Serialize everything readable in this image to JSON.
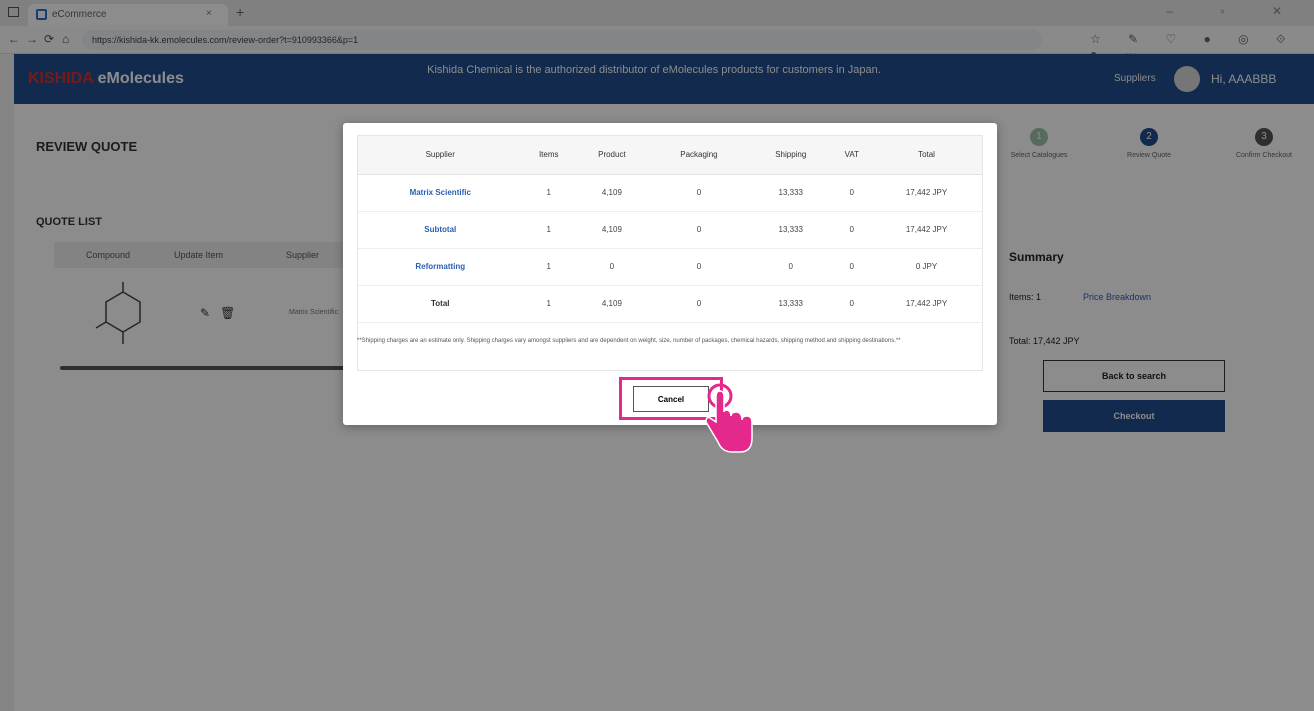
{
  "browser": {
    "tab_title": "eCommerce",
    "tab_close": "×",
    "new_tab": "+",
    "window_controls": "– ▫ ✕",
    "nav": {
      "back": "←",
      "forward": "→",
      "refresh": "⟳",
      "home": "⌂"
    },
    "url": "https://kishida-kk.emolecules.com/review-order?t=910993366&p=1",
    "extensions": "☆ ✎ ♡ ● ◎ ⟐ ● ⋯"
  },
  "header": {
    "logo_brand": "KISHIDA",
    "logo_product": "eMolecules",
    "banner": "Kishida Chemical is the authorized distributor of eMolecules products for customers in Japan.",
    "supplier_link": "Suppliers",
    "greeting": "Hi, AAABBB"
  },
  "page": {
    "title": "REVIEW QUOTE",
    "quote_list_label": "QUOTE LIST",
    "quote_columns": [
      "Compound",
      "Update Item",
      "Supplier"
    ],
    "row_supplier": "Matrix Scientific",
    "steps": [
      {
        "num": "1",
        "label": "Select Catalogues",
        "color": "#9cc3a6"
      },
      {
        "num": "2",
        "label": "Review Quote",
        "color": "#1f4e8c"
      },
      {
        "num": "3",
        "label": "Confirm Checkout",
        "color": "#555555"
      }
    ]
  },
  "summary": {
    "title": "Summary",
    "items": "Items: 1",
    "price_breakdown": "Price Breakdown",
    "total": "Total: 17,442 JPY",
    "back_button": "Back to search",
    "checkout_button": "Checkout"
  },
  "modal": {
    "columns": [
      "Supplier",
      "Items",
      "Product",
      "Packaging",
      "Shipping",
      "VAT",
      "Total"
    ],
    "rows": [
      {
        "supplier": "Matrix Scientific",
        "items": "1",
        "product": "4,109",
        "packaging": "0",
        "shipping": "13,333",
        "vat": "0",
        "total": "17,442 JPY"
      },
      {
        "supplier": "Subtotal",
        "items": "1",
        "product": "4,109",
        "packaging": "0",
        "shipping": "13,333",
        "vat": "0",
        "total": "17,442 JPY"
      },
      {
        "supplier": "Reformatting",
        "items": "1",
        "product": "0",
        "packaging": "0",
        "shipping": "0",
        "vat": "0",
        "total": "0 JPY"
      },
      {
        "supplier": "Total",
        "items": "1",
        "product": "4,109",
        "packaging": "0",
        "shipping": "13,333",
        "vat": "0",
        "total": "17,442 JPY"
      }
    ],
    "note": "**Shipping charges are an estimate only. Shipping charges vary amongst suppliers and are dependent on weight, size, number of packages, chemical hazards, shipping method and shipping destinations.**",
    "cancel_label": "Cancel"
  },
  "colors": {
    "header_bg": "#1f4e8c",
    "link": "#2b5fb3",
    "highlight": "#e4288c"
  }
}
